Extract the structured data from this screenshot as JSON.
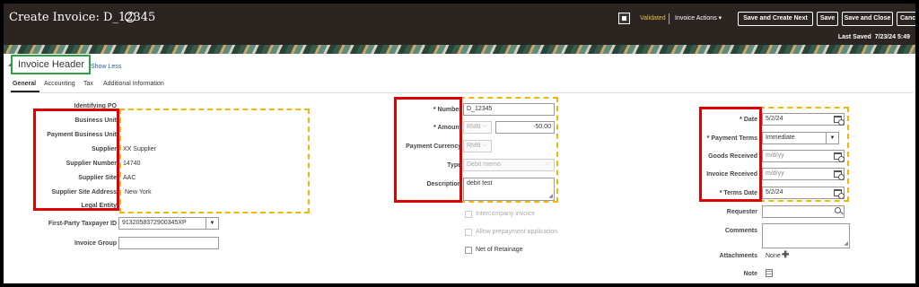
{
  "header": {
    "title": "Create Invoice: D_12345",
    "status": "Validated",
    "actions_menu": "Invoice Actions ▾",
    "buttons": {
      "save_create_next": "Save and Create Next",
      "save": "Save",
      "save_close": "Save and Close",
      "cancel": "Cance"
    },
    "last_saved_label": "Last Saved",
    "last_saved_value": "7/23/24 5:49"
  },
  "section": {
    "title": "Invoice Header",
    "show_less": "Show Less"
  },
  "tabs": [
    "General",
    "Accounting",
    "Tax",
    "Additional Information"
  ],
  "left": {
    "identifying_po": "Identifying PO",
    "business_unit": "Business Unit",
    "payment_business_unit": "Payment Business Unit",
    "supplier_label": "Supplier",
    "supplier_value": "XX Supplier",
    "supplier_number_label": "Supplier Number",
    "supplier_number_value": "14740",
    "supplier_site_label": "Supplier Site",
    "supplier_site_value": "AAC",
    "supplier_site_address_label": "Supplier Site Address",
    "supplier_site_address_value": "New York",
    "legal_entity": "Legal Entity",
    "taxpayer_id_label": "First-Party Taxpayer ID",
    "taxpayer_id_value": "9132058372900345XP",
    "invoice_group_label": "Invoice Group"
  },
  "middle": {
    "number_label": "Number",
    "number_value": "D_12345",
    "amount_label": "Amount",
    "amount_currency": "RMB",
    "amount_value": "-50.00",
    "payment_currency_label": "Payment Currency",
    "payment_currency_value": "RMB",
    "type_label": "Type",
    "type_value": "Debit memo",
    "description_label": "Description",
    "description_value": "debit test",
    "intercompany": "Intercompany invoice",
    "allow_prepayment": "Allow prepayment application",
    "net_of_retainage": "Net of Retainage"
  },
  "right": {
    "date_label": "Date",
    "date_value": "5/2/24",
    "payment_terms_label": "Payment Terms",
    "payment_terms_value": "Immediate",
    "goods_received_label": "Goods Received",
    "goods_received_placeholder": "m/d/yy",
    "invoice_received_label": "Invoice Received",
    "invoice_received_placeholder": "m/d/yy",
    "terms_date_label": "Terms Date",
    "terms_date_value": "5/2/24",
    "requester_label": "Requester",
    "comments_label": "Comments",
    "attachments_label": "Attachments",
    "attachments_value": "None",
    "note_label": "Note"
  },
  "colors": {
    "highlight_red": "#e00000",
    "highlight_yellow": "#f2b705",
    "highlight_green": "#2aa345",
    "header_bg": "#2b2420"
  }
}
